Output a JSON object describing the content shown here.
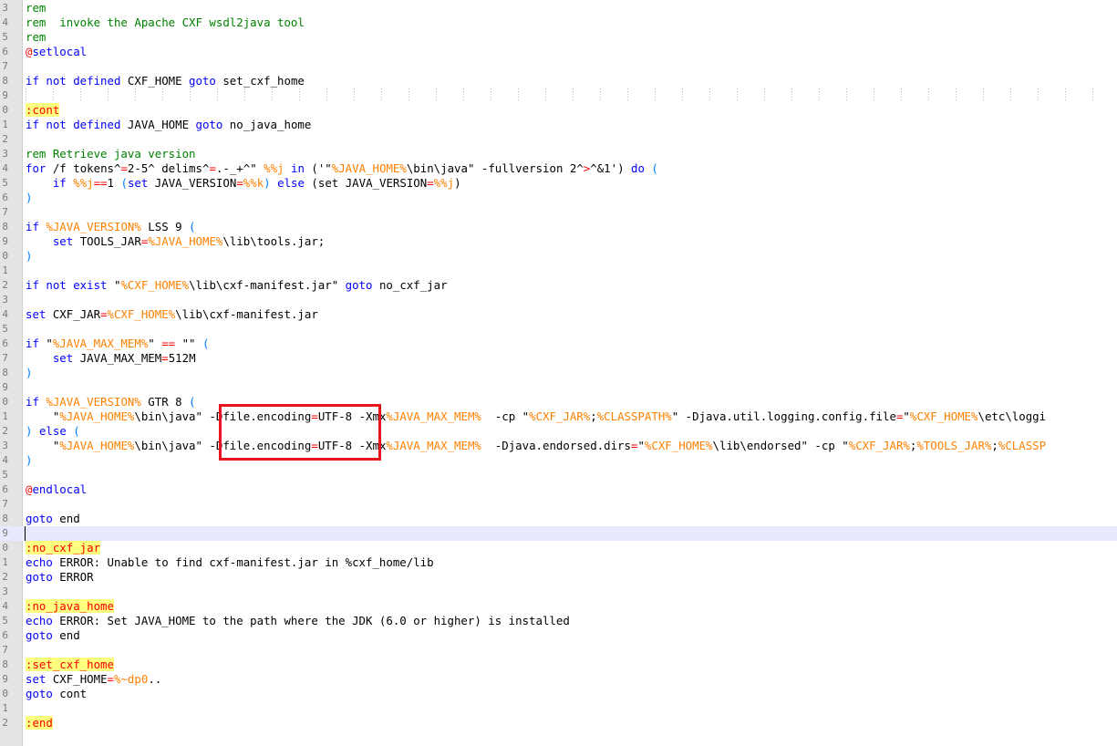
{
  "editor": {
    "current_line_index": 36,
    "highlight_box_color": "#e8141e",
    "colors": {
      "keyword": "#0000ff",
      "comment": "#008000",
      "variable": "#ff8000",
      "operator": "#ff0000",
      "bracket": "#0080ff",
      "label": "#ff0000",
      "label_bg": "#ffff80",
      "current_line_bg": "#e8e8ff"
    },
    "lines": [
      {
        "n": "3",
        "tokens": [
          [
            "cm",
            "rem"
          ]
        ]
      },
      {
        "n": "4",
        "tokens": [
          [
            "cm",
            "rem  invoke the Apache CXF wsdl2java tool"
          ]
        ]
      },
      {
        "n": "5",
        "tokens": [
          [
            "cm",
            "rem"
          ]
        ]
      },
      {
        "n": "6",
        "tokens": [
          [
            "at",
            "@"
          ],
          [
            "kw",
            "setlocal"
          ]
        ]
      },
      {
        "n": "7",
        "tokens": []
      },
      {
        "n": "8",
        "tokens": [
          [
            "kw",
            "if not defined"
          ],
          [
            "plain",
            " CXF_HOME "
          ],
          [
            "kw",
            "goto"
          ],
          [
            "plain",
            " set_cxf_home"
          ]
        ]
      },
      {
        "n": "9",
        "tokens": []
      },
      {
        "n": "0",
        "tokens": [
          [
            "lbl",
            ":cont"
          ]
        ]
      },
      {
        "n": "1",
        "tokens": [
          [
            "kw",
            "if not defined"
          ],
          [
            "plain",
            " JAVA_HOME "
          ],
          [
            "kw",
            "goto"
          ],
          [
            "plain",
            " no_java_home"
          ]
        ]
      },
      {
        "n": "2",
        "tokens": []
      },
      {
        "n": "3",
        "tokens": [
          [
            "cm",
            "rem Retrieve java version"
          ]
        ]
      },
      {
        "n": "4",
        "tokens": [
          [
            "kw",
            "for"
          ],
          [
            "plain",
            " /f tokens^"
          ],
          [
            "op",
            "="
          ],
          [
            "plain",
            "2-5^ delims^"
          ],
          [
            "op",
            "="
          ],
          [
            "plain",
            ".-_+^\" "
          ],
          [
            "var",
            "%%j"
          ],
          [
            "plain",
            " "
          ],
          [
            "kw",
            "in"
          ],
          [
            "plain",
            " ('\""
          ],
          [
            "var",
            "%JAVA_HOME%"
          ],
          [
            "plain",
            "\\bin\\java\" -fullversion 2^"
          ],
          [
            "op",
            ">"
          ],
          [
            "plain",
            "^&1') "
          ],
          [
            "kw",
            "do"
          ],
          [
            "plain",
            " "
          ],
          [
            "br",
            "("
          ]
        ]
      },
      {
        "n": "5",
        "tokens": [
          [
            "plain",
            "    "
          ],
          [
            "kw",
            "if"
          ],
          [
            "plain",
            " "
          ],
          [
            "var",
            "%%j"
          ],
          [
            "op",
            "=="
          ],
          [
            "plain",
            "1 "
          ],
          [
            "br",
            "("
          ],
          [
            "kw",
            "set"
          ],
          [
            "plain",
            " JAVA_VERSION"
          ],
          [
            "op",
            "="
          ],
          [
            "var",
            "%%k"
          ],
          [
            "br",
            ")"
          ],
          [
            "plain",
            " "
          ],
          [
            "kw",
            "else"
          ],
          [
            "plain",
            " (set JAVA_VERSION"
          ],
          [
            "op",
            "="
          ],
          [
            "var",
            "%%j"
          ],
          [
            "plain",
            ")"
          ]
        ]
      },
      {
        "n": "6",
        "tokens": [
          [
            "br",
            ")"
          ]
        ]
      },
      {
        "n": "7",
        "tokens": []
      },
      {
        "n": "8",
        "tokens": [
          [
            "kw",
            "if"
          ],
          [
            "plain",
            " "
          ],
          [
            "var",
            "%JAVA_VERSION%"
          ],
          [
            "plain",
            " LSS 9 "
          ],
          [
            "br",
            "("
          ]
        ]
      },
      {
        "n": "9",
        "tokens": [
          [
            "plain",
            "    "
          ],
          [
            "kw",
            "set"
          ],
          [
            "plain",
            " TOOLS_JAR"
          ],
          [
            "op",
            "="
          ],
          [
            "var",
            "%JAVA_HOME%"
          ],
          [
            "plain",
            "\\lib\\tools.jar;"
          ]
        ]
      },
      {
        "n": "0",
        "tokens": [
          [
            "br",
            ")"
          ]
        ]
      },
      {
        "n": "1",
        "tokens": []
      },
      {
        "n": "2",
        "tokens": [
          [
            "kw",
            "if not exist"
          ],
          [
            "plain",
            " \""
          ],
          [
            "var",
            "%CXF_HOME%"
          ],
          [
            "plain",
            "\\lib\\cxf-manifest.jar\" "
          ],
          [
            "kw",
            "goto"
          ],
          [
            "plain",
            " no_cxf_jar"
          ]
        ]
      },
      {
        "n": "3",
        "tokens": []
      },
      {
        "n": "4",
        "tokens": [
          [
            "kw",
            "set"
          ],
          [
            "plain",
            " CXF_JAR"
          ],
          [
            "op",
            "="
          ],
          [
            "var",
            "%CXF_HOME%"
          ],
          [
            "plain",
            "\\lib\\cxf-manifest.jar"
          ]
        ]
      },
      {
        "n": "5",
        "tokens": []
      },
      {
        "n": "6",
        "tokens": [
          [
            "kw",
            "if"
          ],
          [
            "plain",
            " \""
          ],
          [
            "var",
            "%JAVA_MAX_MEM%"
          ],
          [
            "plain",
            "\" "
          ],
          [
            "op",
            "=="
          ],
          [
            "plain",
            " \"\" "
          ],
          [
            "br",
            "("
          ]
        ]
      },
      {
        "n": "7",
        "tokens": [
          [
            "plain",
            "    "
          ],
          [
            "kw",
            "set"
          ],
          [
            "plain",
            " JAVA_MAX_MEM"
          ],
          [
            "op",
            "="
          ],
          [
            "plain",
            "512M"
          ]
        ]
      },
      {
        "n": "8",
        "tokens": [
          [
            "br",
            ")"
          ]
        ]
      },
      {
        "n": "9",
        "tokens": []
      },
      {
        "n": "0",
        "tokens": [
          [
            "kw",
            "if"
          ],
          [
            "plain",
            " "
          ],
          [
            "var",
            "%JAVA_VERSION%"
          ],
          [
            "plain",
            " GTR 8 "
          ],
          [
            "br",
            "("
          ]
        ]
      },
      {
        "n": "1",
        "tokens": [
          [
            "plain",
            "    \""
          ],
          [
            "var",
            "%JAVA_HOME%"
          ],
          [
            "plain",
            "\\bin\\java\" -Dfile.encoding"
          ],
          [
            "op",
            "="
          ],
          [
            "plain",
            "UTF-8 -Xmx"
          ],
          [
            "var",
            "%JAVA_MAX_MEM%"
          ],
          [
            "plain",
            "  -cp \""
          ],
          [
            "var",
            "%CXF_JAR%"
          ],
          [
            "plain",
            ";"
          ],
          [
            "var",
            "%CLASSPATH%"
          ],
          [
            "plain",
            "\" -Djava.util.logging.config.file"
          ],
          [
            "op",
            "="
          ],
          [
            "plain",
            "\""
          ],
          [
            "var",
            "%CXF_HOME%"
          ],
          [
            "plain",
            "\\etc\\loggi"
          ]
        ]
      },
      {
        "n": "2",
        "tokens": [
          [
            "br",
            ")"
          ],
          [
            "plain",
            " "
          ],
          [
            "kw",
            "else"
          ],
          [
            "plain",
            " "
          ],
          [
            "br",
            "("
          ]
        ]
      },
      {
        "n": "3",
        "tokens": [
          [
            "plain",
            "    \""
          ],
          [
            "var",
            "%JAVA_HOME%"
          ],
          [
            "plain",
            "\\bin\\java\" -Dfile.encoding"
          ],
          [
            "op",
            "="
          ],
          [
            "plain",
            "UTF-8 -Xmx"
          ],
          [
            "var",
            "%JAVA_MAX_MEM%"
          ],
          [
            "plain",
            "  -Djava.endorsed.dirs"
          ],
          [
            "op",
            "="
          ],
          [
            "plain",
            "\""
          ],
          [
            "var",
            "%CXF_HOME%"
          ],
          [
            "plain",
            "\\lib\\endorsed\" -cp \""
          ],
          [
            "var",
            "%CXF_JAR%"
          ],
          [
            "plain",
            ";"
          ],
          [
            "var",
            "%TOOLS_JAR%"
          ],
          [
            "plain",
            ";"
          ],
          [
            "var",
            "%CLASSP"
          ]
        ]
      },
      {
        "n": "4",
        "tokens": [
          [
            "br",
            ")"
          ]
        ]
      },
      {
        "n": "5",
        "tokens": []
      },
      {
        "n": "6",
        "tokens": [
          [
            "at",
            "@"
          ],
          [
            "kw",
            "endlocal"
          ]
        ]
      },
      {
        "n": "7",
        "tokens": []
      },
      {
        "n": "8",
        "tokens": [
          [
            "kw",
            "goto"
          ],
          [
            "plain",
            " end"
          ]
        ]
      },
      {
        "n": "9",
        "tokens": []
      },
      {
        "n": "0",
        "tokens": [
          [
            "lbl",
            ":no_cxf_jar"
          ]
        ]
      },
      {
        "n": "1",
        "tokens": [
          [
            "kw",
            "echo"
          ],
          [
            "plain",
            " ERROR: Unable to find cxf-manifest.jar in %cxf_home/lib"
          ]
        ]
      },
      {
        "n": "2",
        "tokens": [
          [
            "kw",
            "goto"
          ],
          [
            "plain",
            " ERROR"
          ]
        ]
      },
      {
        "n": "3",
        "tokens": []
      },
      {
        "n": "4",
        "tokens": [
          [
            "lbl",
            ":no_java_home"
          ]
        ]
      },
      {
        "n": "5",
        "tokens": [
          [
            "kw",
            "echo"
          ],
          [
            "plain",
            " ERROR: Set JAVA_HOME to the path where the JDK (6.0 or higher) is installed"
          ]
        ]
      },
      {
        "n": "6",
        "tokens": [
          [
            "kw",
            "goto"
          ],
          [
            "plain",
            " end"
          ]
        ]
      },
      {
        "n": "7",
        "tokens": []
      },
      {
        "n": "8",
        "tokens": [
          [
            "lbl",
            ":set_cxf_home"
          ]
        ]
      },
      {
        "n": "9",
        "tokens": [
          [
            "kw",
            "set"
          ],
          [
            "plain",
            " CXF_HOME"
          ],
          [
            "op",
            "="
          ],
          [
            "var",
            "%~dp0"
          ],
          [
            "plain",
            ".."
          ]
        ]
      },
      {
        "n": "0",
        "tokens": [
          [
            "kw",
            "goto"
          ],
          [
            "plain",
            " cont"
          ]
        ]
      },
      {
        "n": "1",
        "tokens": []
      },
      {
        "n": "2",
        "tokens": [
          [
            "lbl",
            ":end"
          ]
        ]
      }
    ]
  }
}
